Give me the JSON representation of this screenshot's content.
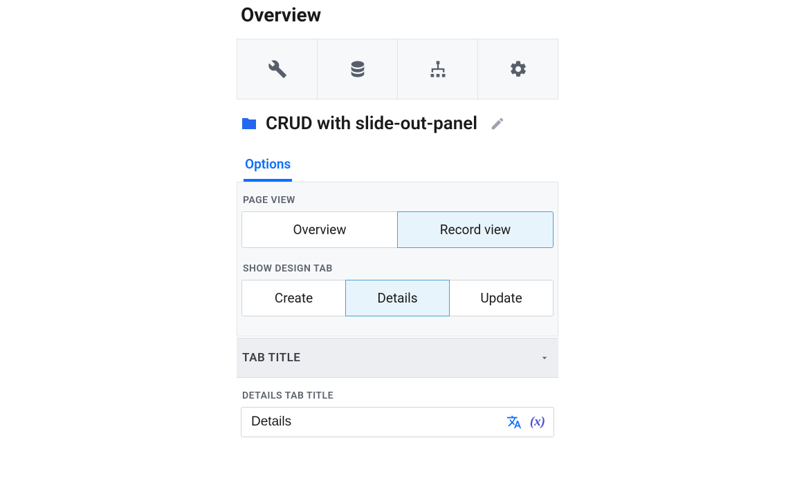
{
  "header": {
    "title": "Overview"
  },
  "topnav": {
    "icons": [
      "tools-icon",
      "database-icon",
      "sitemap-icon",
      "gear-icon"
    ]
  },
  "page": {
    "folder_icon": "folder-icon",
    "title": "CRUD with slide-out-panel",
    "edit_icon": "pencil-icon"
  },
  "tabs": {
    "options_label": "Options"
  },
  "options": {
    "page_view_label": "PAGE VIEW",
    "page_view": {
      "overview": "Overview",
      "record_view": "Record view",
      "selected": "record_view"
    },
    "show_design_tab_label": "SHOW DESIGN TAB",
    "show_design_tab": {
      "create": "Create",
      "details": "Details",
      "update": "Update",
      "selected": "details"
    }
  },
  "tab_title_section": {
    "header": "TAB TITLE",
    "details_label": "DETAILS TAB TITLE",
    "details_value": "Details",
    "var_token": "(x)"
  }
}
